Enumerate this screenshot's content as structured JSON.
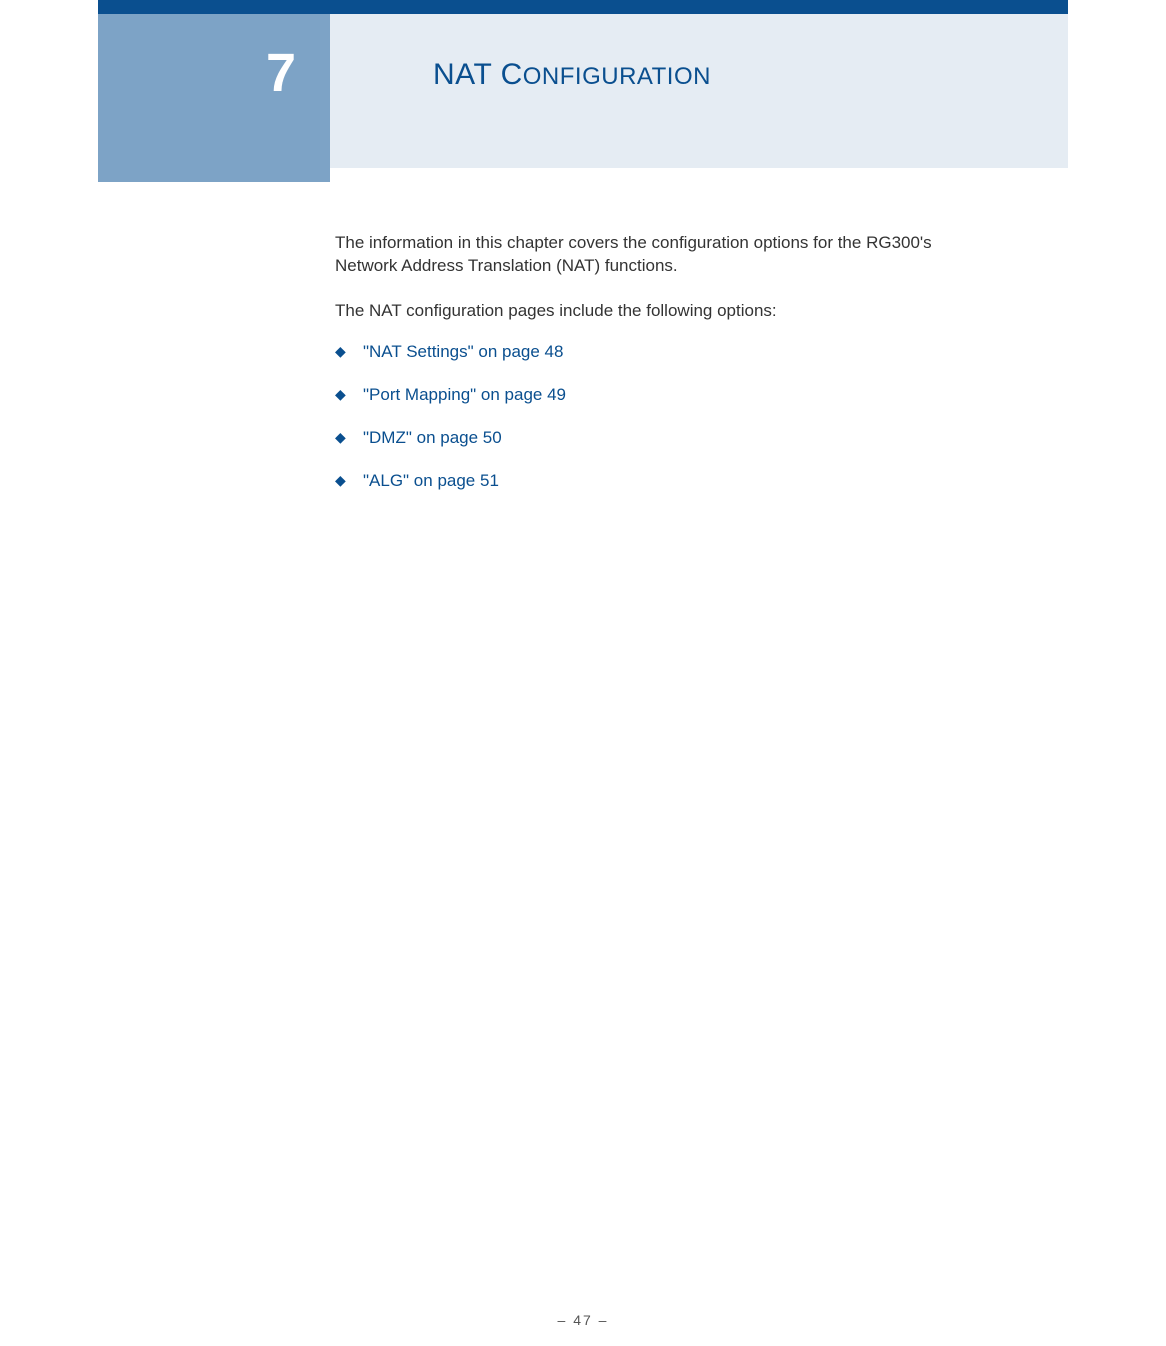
{
  "chapter": {
    "number": "7",
    "title_first": "NAT C",
    "title_rest": "ONFIGURATION"
  },
  "body": {
    "intro": "The information in this chapter covers the configuration options for the RG300's Network Address Translation (NAT) functions.",
    "lead": "The NAT configuration pages include the following options:",
    "links": [
      {
        "text": "\"NAT Settings\" on page 48"
      },
      {
        "text": "\"Port Mapping\" on page 49"
      },
      {
        "text": "\"DMZ\" on page 50"
      },
      {
        "text": "\"ALG\" on page 51"
      }
    ]
  },
  "footer": {
    "page_number": "–  47  –"
  }
}
